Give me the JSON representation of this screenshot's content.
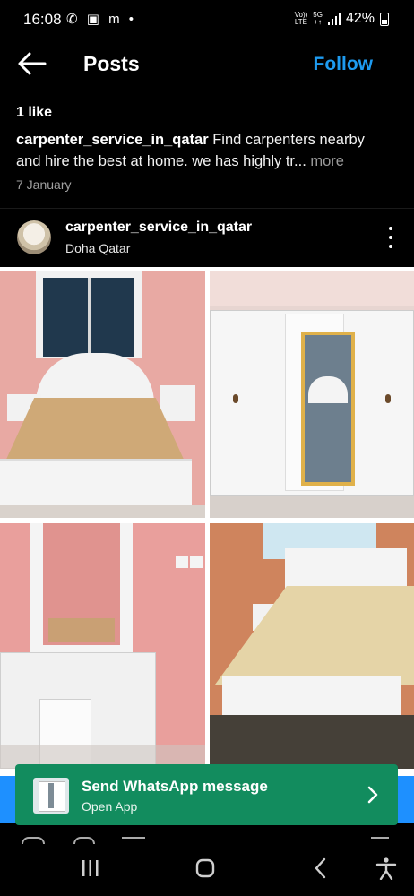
{
  "status_bar": {
    "time": "16:08",
    "left_icons": "✆ ▣ m •",
    "network_top": "Vo))",
    "network_bottom": "LTE",
    "gen_top": "5G",
    "gen_bottom": "+↑",
    "battery_percent": "42%"
  },
  "header": {
    "title": "Posts",
    "follow_label": "Follow",
    "back_icon": "arrow-left-icon"
  },
  "post": {
    "likes": "1 like",
    "caption_user": "carpenter_service_in_qatar",
    "caption_text": " Find carpenters nearby and hire the best at home. we has highly tr",
    "ellipsis": "...",
    "more_label": " more",
    "date": "7 January",
    "author": {
      "username": "carpenter_service_in_qatar",
      "location": "Doha Qatar"
    },
    "photos": [
      {
        "subject": "white bed frame with nightstands and mirror"
      },
      {
        "subject": "white sliding wardrobe with mirror"
      },
      {
        "subject": "white dressing table with mirror and stool"
      },
      {
        "subject": "white bed with plastic-wrapped mattress"
      }
    ]
  },
  "whatsapp_banner": {
    "title": "Send WhatsApp message",
    "subtitle": "Open App",
    "icon": "chevron-right-icon"
  },
  "navigation_bar": {
    "items": [
      "recent-apps-icon",
      "home-icon",
      "back-icon",
      "accessibility-icon"
    ]
  }
}
